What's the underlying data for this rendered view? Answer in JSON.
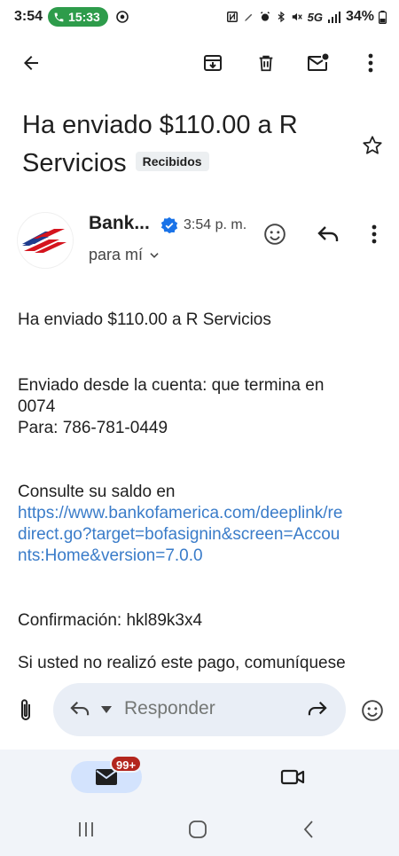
{
  "status_bar": {
    "time": "3:54",
    "call_timer": "15:33",
    "network": "5G",
    "battery": "34%"
  },
  "toolbar": {
    "back_icon": "arrow-back-icon",
    "archive_icon": "archive-icon",
    "delete_icon": "trash-icon",
    "mark_unread_icon": "mail-unread-icon",
    "more_icon": "more-vert-icon"
  },
  "email": {
    "subject": "Ha enviado $110.00 a R Servicios",
    "label_chip": "Recibidos",
    "sender_name": "Bank...",
    "time": "3:54 p. m.",
    "recipient": "para mí",
    "body": {
      "line1": "Ha enviado $110.00 a R Servicios",
      "line2": "Enviado desde la cuenta: que termina en 0074",
      "line3": "Para: 786-781-0449",
      "balance_prefix": "Consulte su saldo en",
      "balance_link": "https://www.bankofamerica.com/deeplink/redirect.go?target=bofasignin&screen=Accounts:Home&version=7.0.0",
      "confirmation": "Confirmación: hkl89k3x4",
      "truncated": "Si usted no realizó este pago, comuníquese"
    }
  },
  "reply_bar": {
    "placeholder": "Responder"
  },
  "bottom_nav": {
    "mail_badge": "99+"
  },
  "colors": {
    "link": "#3a7cc9",
    "accent_pill": "#d3e3fd",
    "badge": "#b3261e",
    "call_pill": "#2e9c4b",
    "verified": "#1a73e8"
  }
}
